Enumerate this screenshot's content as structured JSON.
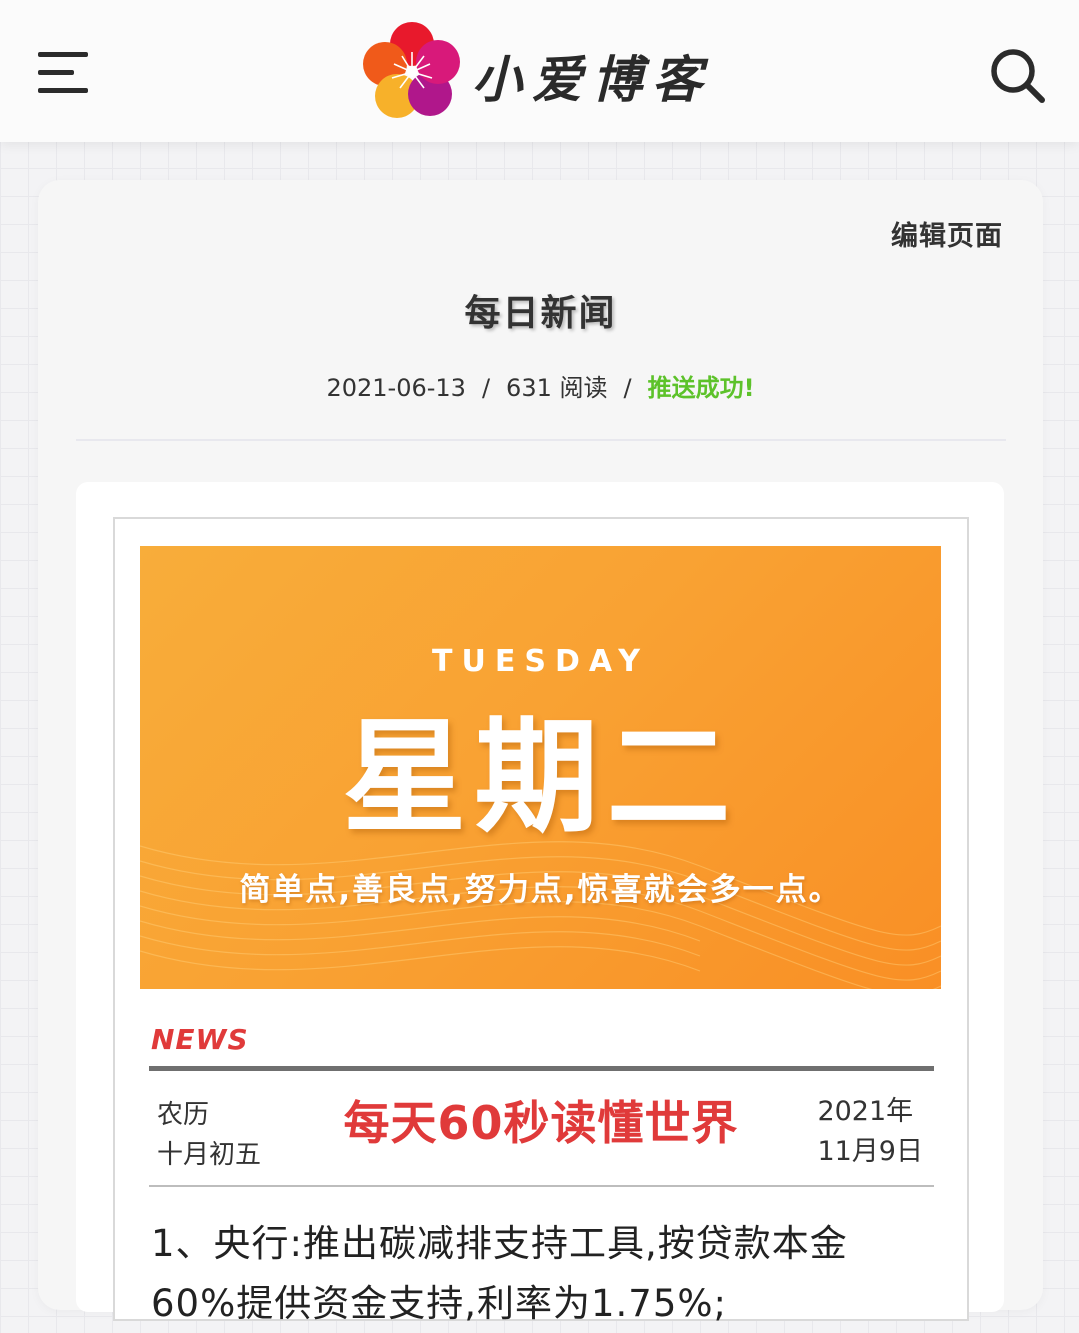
{
  "header": {
    "site_name": "小爱博客",
    "menu_icon": "hamburger-menu-icon",
    "search_icon": "search-icon",
    "logo_colors": [
      "#e8192c",
      "#f07f1a",
      "#f7b12a",
      "#c1198a",
      "#9b1b8f"
    ]
  },
  "article": {
    "edit_label": "编辑页面",
    "title": "每日新闻",
    "date": "2021-06-13",
    "separator": "/",
    "reads": "631 阅读",
    "status": "推送成功!",
    "status_color": "#5dc22a"
  },
  "news_card": {
    "banner": {
      "weekday_en": "TUESDAY",
      "weekday_cn": "星期二",
      "motto": "简单点,善良点,努力点,惊喜就会多一点。",
      "color": "#f9a233"
    },
    "news_label": "NEWS",
    "lunar_line1": "农历",
    "lunar_line2": "十月初五",
    "headline": "每天60秒读懂世界",
    "headline_color": "#e03a3a",
    "date_line1": "2021年",
    "date_line2": "11月9日",
    "items": [
      "1、央行:推出碳减排支持工具,按贷款本金",
      "60%提供资金支持,利率为1.75%;"
    ]
  }
}
